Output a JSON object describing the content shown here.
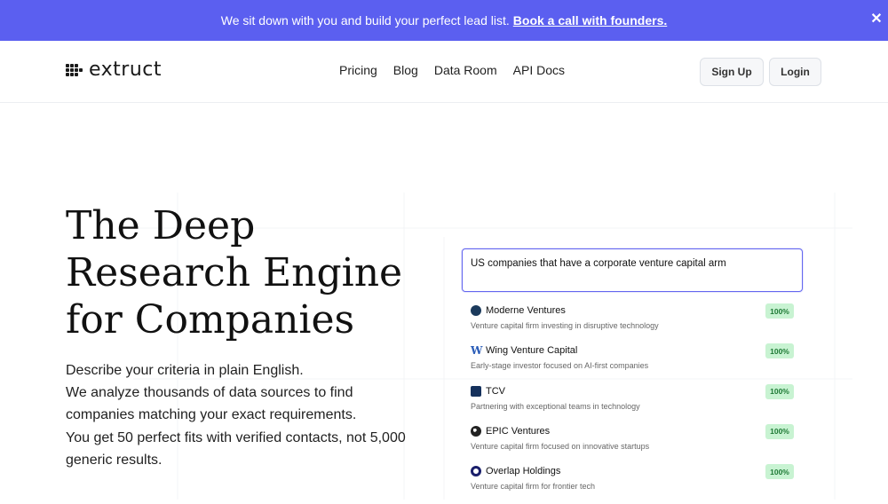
{
  "banner": {
    "text": "We sit down with you and build your perfect lead list.",
    "link": "Book a call with founders.",
    "close": "✕"
  },
  "nav": {
    "logo": "extruct",
    "links": [
      "Pricing",
      "Blog",
      "Data Room",
      "API Docs"
    ],
    "signup": "Sign Up",
    "login": "Login"
  },
  "hero": {
    "title_lines": [
      "The Deep",
      "Research Engine",
      "for Companies"
    ],
    "desc_lines": [
      "Describe your criteria in plain English.",
      "We analyze thousands of data sources to find",
      "companies matching your exact requirements.",
      "You get 50 perfect fits with verified contacts, not 5,000",
      "generic results."
    ]
  },
  "search": {
    "query": "US companies that have a corporate venture capital arm"
  },
  "results": [
    {
      "name": "Moderne Ventures",
      "desc": "Venture capital firm investing in disruptive technology",
      "score": "100%",
      "icon": "moderne-logo-icon",
      "color": "#1b3a5c"
    },
    {
      "name": "Wing Venture Capital",
      "desc": "Early-stage investor focused on AI-first companies",
      "score": "100%",
      "icon": "wing-logo-icon",
      "color": "#2b5db8"
    },
    {
      "name": "TCV",
      "desc": "Partnering with exceptional teams in technology",
      "score": "100%",
      "icon": "tcv-logo-icon",
      "color": "#15315c"
    },
    {
      "name": "EPIC Ventures",
      "desc": "Venture capital firm focused on innovative startups",
      "score": "100%",
      "icon": "epic-logo-icon",
      "color": "#222222"
    },
    {
      "name": "Overlap Holdings",
      "desc": "Venture capital firm for frontier tech",
      "score": "100%",
      "icon": "overlap-logo-icon",
      "color": "#1a1f6b"
    }
  ],
  "colors": {
    "accent": "#5b5ff0",
    "badge_bg": "#c8f3d2",
    "badge_text": "#1e7a35"
  }
}
